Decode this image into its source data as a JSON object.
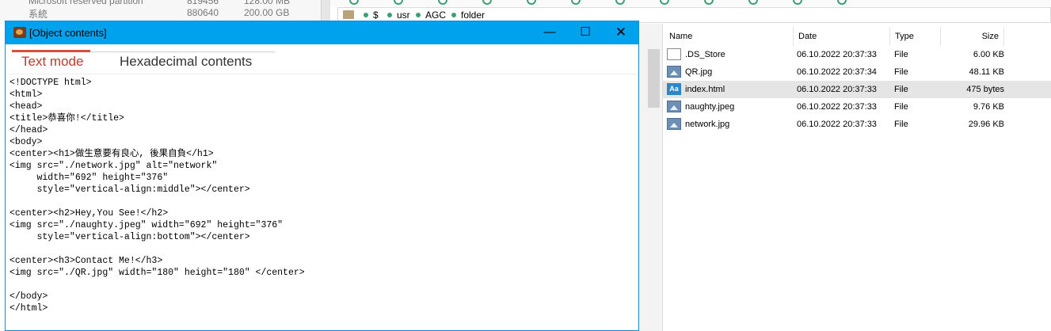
{
  "background": {
    "partitions": [
      {
        "name": "Microsoft reserved partition",
        "sectors": "819456",
        "size": "128.00 MB"
      },
      {
        "name": "系統",
        "sectors": "880640",
        "size": "200.00 GB"
      }
    ],
    "breadcrumb": [
      "$",
      "usr",
      "AGC",
      "folder"
    ]
  },
  "dialog": {
    "title": "[Object contents]",
    "buttons": {
      "minimize": "—",
      "maximize": "☐",
      "close": "✕"
    },
    "tabs": [
      {
        "label": "Text mode",
        "active": true
      },
      {
        "label": "Hexadecimal contents",
        "active": false
      }
    ],
    "content_lines": [
      "<!DOCTYPE html>",
      "<html>",
      "<head>",
      "<title>恭喜你!</title>",
      "</head>",
      "<body>",
      "<center><h1>做生意要有良心, 後果自負</h1>",
      "<img src=\"./network.jpg\" alt=\"network\"",
      "     width=\"692\" height=\"376\"",
      "     style=\"vertical-align:middle\"></center>",
      "",
      "<center><h2>Hey,You See!</h2>",
      "<img src=\"./naughty.jpeg\" width=\"692\" height=\"376\"",
      "     style=\"vertical-align:bottom\"></center>",
      "",
      "<center><h3>Contact Me!</h3>",
      "<img src=\"./QR.jpg\" width=\"180\" height=\"180\" </center>",
      "",
      "</body>",
      "</html>"
    ]
  },
  "filelist": {
    "columns": {
      "name": "Name",
      "date": "Date",
      "type": "Type",
      "size": "Size"
    },
    "rows": [
      {
        "icon": "blank-file-icon",
        "name": ".DS_Store",
        "date": "06.10.2022 20:37:33",
        "type": "File",
        "size": "6.00 KB",
        "selected": false
      },
      {
        "icon": "image-file-icon",
        "name": "QR.jpg",
        "date": "06.10.2022 20:37:34",
        "type": "File",
        "size": "48.11 KB",
        "selected": false
      },
      {
        "icon": "html-file-icon",
        "icon_text": "Aa",
        "name": "index.html",
        "date": "06.10.2022 20:37:33",
        "type": "File",
        "size": "475 bytes",
        "selected": true
      },
      {
        "icon": "image-file-icon",
        "name": "naughty.jpeg",
        "date": "06.10.2022 20:37:33",
        "type": "File",
        "size": "9.76 KB",
        "selected": false
      },
      {
        "icon": "image-file-icon",
        "name": "network.jpg",
        "date": "06.10.2022 20:37:33",
        "type": "File",
        "size": "29.96 KB",
        "selected": false
      }
    ]
  },
  "colors": {
    "titlebar": "#00a2ed",
    "active_tab": "#d84f3f",
    "selected_row": "#e5e5e5",
    "breadcrumb_dot": "#3aa174"
  }
}
